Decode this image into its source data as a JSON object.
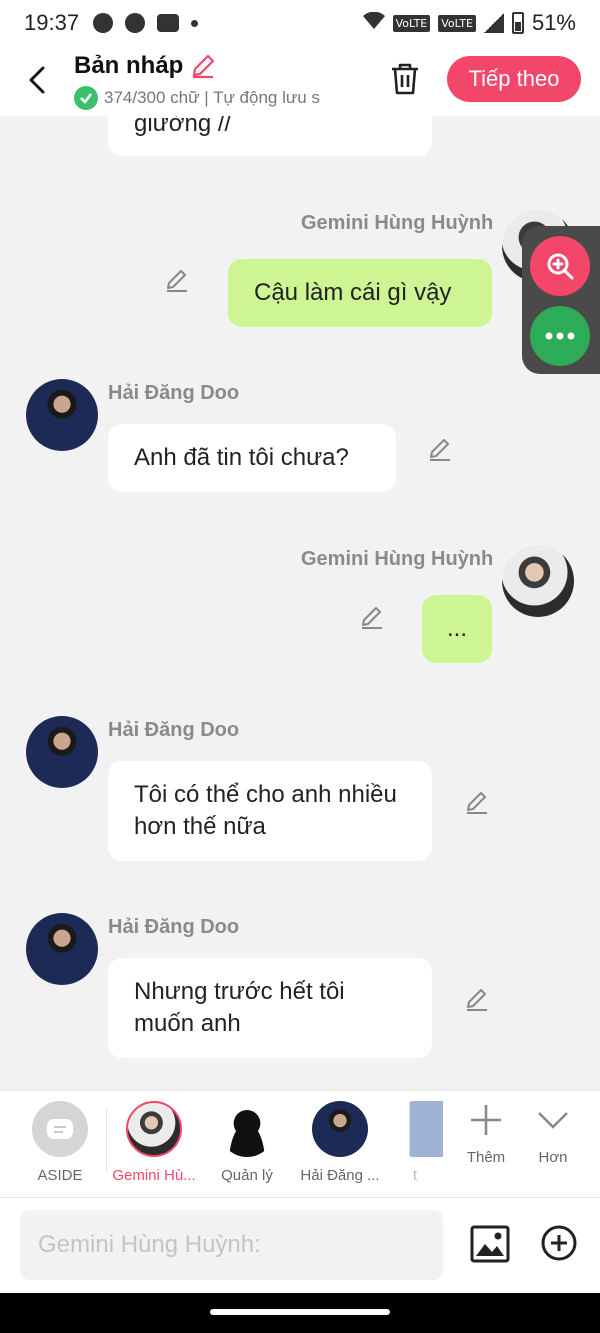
{
  "status_bar": {
    "time": "19:37",
    "net1": "VoLTE",
    "net2": "VoLTE",
    "battery": "51%"
  },
  "header": {
    "title": "Bản nháp",
    "subtitle": "374/300 chữ | Tự động lưu s",
    "next_label": "Tiếp theo"
  },
  "messages": [
    {
      "sender": "",
      "side": "left",
      "text": "giường //"
    },
    {
      "sender": "Gemini Hùng Huỳnh",
      "side": "right",
      "text": "Cậu làm cái gì vậy"
    },
    {
      "sender": "Hải Đăng Doo",
      "side": "left",
      "text": "Anh đã tin tôi chưa?"
    },
    {
      "sender": "Gemini Hùng Huỳnh",
      "side": "right",
      "text": "..."
    },
    {
      "sender": "Hải Đăng Doo",
      "side": "left",
      "text": "Tôi có thể cho anh nhiều hơn thế nữa"
    },
    {
      "sender": "Hải Đăng Doo",
      "side": "left",
      "text": "Nhưng trước hết tôi muốn anh"
    }
  ],
  "characters": [
    {
      "name": "ASIDE"
    },
    {
      "name": "Gemini Hù..."
    },
    {
      "name": "Quản lý"
    },
    {
      "name": "Hải Đăng ..."
    },
    {
      "name": "t"
    }
  ],
  "tools": {
    "more_label": "Thêm",
    "collapse_label": "Hơn"
  },
  "input": {
    "placeholder": "Gemini Hùng Huỳnh:"
  },
  "colors": {
    "accent": "#f2466a",
    "user_bubble": "#cdf593",
    "other_bubble": "#ffffff",
    "background": "#f2f2f2"
  }
}
